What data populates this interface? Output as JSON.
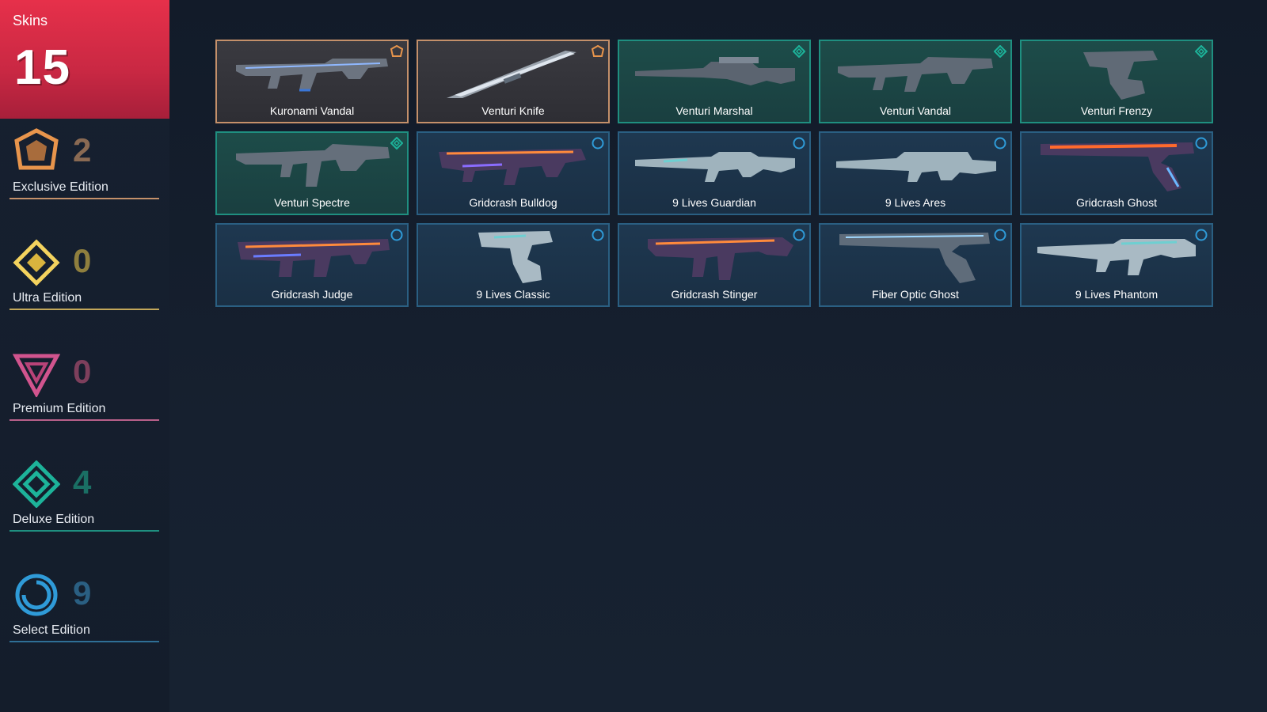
{
  "header": {
    "label": "Skins",
    "count": "15"
  },
  "tiers": [
    {
      "id": "exclusive",
      "count": "2",
      "label": "Exclusive Edition",
      "color": "#e8954c",
      "icon": "exclusive-edition-icon"
    },
    {
      "id": "ultra",
      "count": "0",
      "label": "Ultra Edition",
      "color": "#f4d35e",
      "icon": "ultra-edition-icon"
    },
    {
      "id": "premium",
      "count": "0",
      "label": "Premium Edition",
      "color": "#d1548e",
      "icon": "premium-edition-icon"
    },
    {
      "id": "deluxe",
      "count": "4",
      "label": "Deluxe Edition",
      "color": "#1db39a",
      "icon": "deluxe-edition-icon"
    },
    {
      "id": "select",
      "count": "9",
      "label": "Select Edition",
      "color": "#2f9bd8",
      "icon": "select-edition-icon"
    }
  ],
  "skins": [
    {
      "name": "Kuronami Vandal",
      "tier": "exclusive"
    },
    {
      "name": "Venturi Knife",
      "tier": "exclusive"
    },
    {
      "name": "Venturi Marshal",
      "tier": "deluxe"
    },
    {
      "name": "Venturi Vandal",
      "tier": "deluxe"
    },
    {
      "name": "Venturi Frenzy",
      "tier": "deluxe"
    },
    {
      "name": "Venturi Spectre",
      "tier": "deluxe"
    },
    {
      "name": "Gridcrash Bulldog",
      "tier": "select"
    },
    {
      "name": "9 Lives Guardian",
      "tier": "select"
    },
    {
      "name": "9 Lives Ares",
      "tier": "select"
    },
    {
      "name": "Gridcrash Ghost",
      "tier": "select"
    },
    {
      "name": "Gridcrash Judge",
      "tier": "select"
    },
    {
      "name": "9 Lives Classic",
      "tier": "select"
    },
    {
      "name": "Gridcrash Stinger",
      "tier": "select"
    },
    {
      "name": "Fiber Optic Ghost",
      "tier": "select"
    },
    {
      "name": "9 Lives Phantom",
      "tier": "select"
    }
  ],
  "colors": {
    "exclusive_card_bg": "#3a3a3e",
    "exclusive_border": "#c4906a",
    "deluxe_card_bg": "#1c4a48",
    "deluxe_border": "#1f8f80",
    "select_card_bg": "#1c3347",
    "select_border": "#2a5f82"
  }
}
